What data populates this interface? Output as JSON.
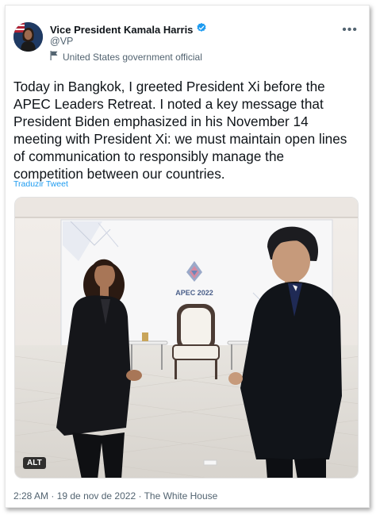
{
  "author": {
    "name": "Vice President Kamala Harris",
    "handle": "@VP",
    "affiliation": "United States government official"
  },
  "tweet": {
    "text": "Today in Bangkok, I greeted President Xi before the\nAPEC Leaders Retreat. I noted a key message that\nPresident Biden emphasized in his November 14\nmeeting with President Xi: we must maintain open lines\nof communication to responsibly manage the\ncompetition between our countries.",
    "translate_label": "Traduzir Tweet"
  },
  "media": {
    "alt_badge": "ALT",
    "backdrop_sign": "APEC 2022"
  },
  "meta": {
    "time": "2:28 AM",
    "separator_1": " · ",
    "date": "19 de nov de 2022",
    "separator_2": " · ",
    "source": "The White House"
  },
  "colors": {
    "verified_blue": "#1d9bf0",
    "link_blue": "#1d9bf0",
    "secondary_text": "#536471"
  },
  "icons": [
    "verified-badge-icon",
    "government-flag-icon",
    "more-icon"
  ]
}
